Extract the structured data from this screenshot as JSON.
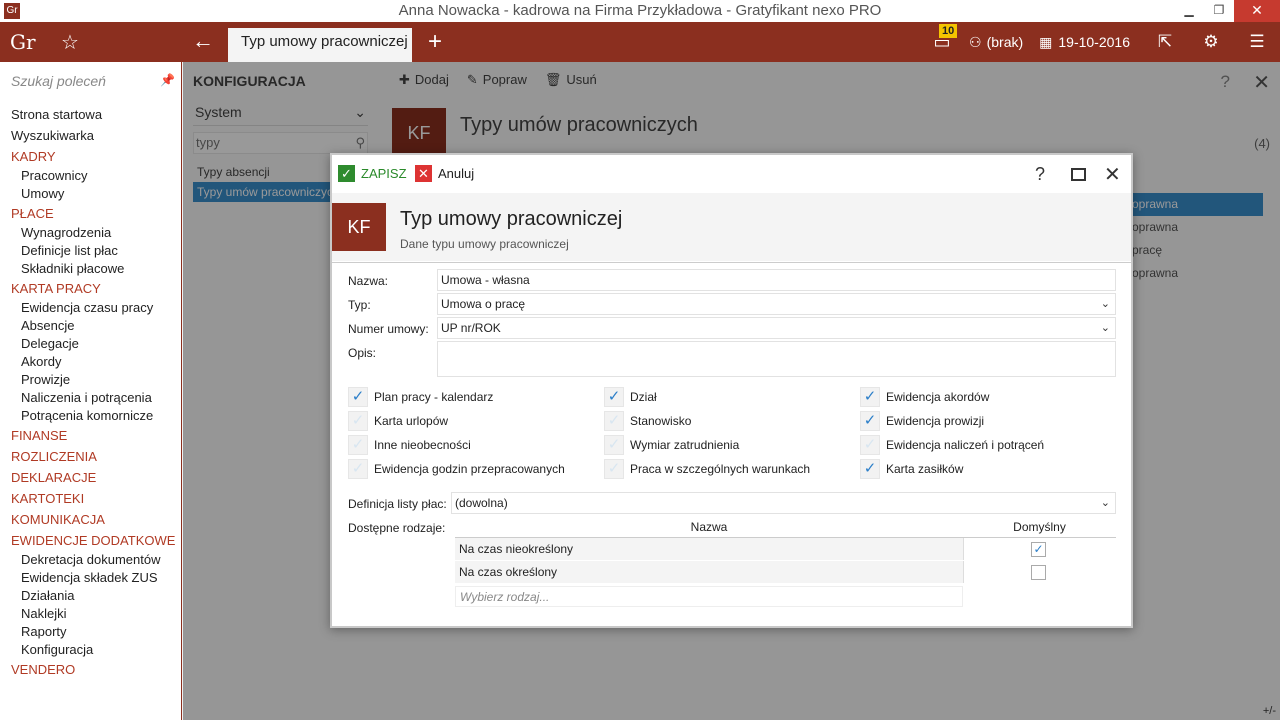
{
  "window": {
    "title": "Anna Nowacka - kadrowa na Firma Przykładowa - Gratyfikant nexo PRO",
    "app_icon": "Gr",
    "minimize": "▁",
    "restore": "❐",
    "close": "✕"
  },
  "appbar": {
    "logo": "Gr",
    "active_tab": "Typ umowy pracowniczej",
    "notifications_count": "10",
    "user": "(brak)",
    "date": "19-10-2016"
  },
  "sidebar": {
    "search_placeholder": "Szukaj poleceń",
    "items": [
      {
        "label": "Strona startowa"
      },
      {
        "label": "Wyszukiwarka"
      },
      {
        "label": "KADRY"
      },
      {
        "label": "Pracownicy"
      },
      {
        "label": "Umowy"
      },
      {
        "label": "PŁACE"
      },
      {
        "label": "Wynagrodzenia"
      },
      {
        "label": "Definicje list płac"
      },
      {
        "label": "Składniki płacowe"
      },
      {
        "label": "KARTA PRACY"
      },
      {
        "label": "Ewidencja czasu pracy"
      },
      {
        "label": "Absencje"
      },
      {
        "label": "Delegacje"
      },
      {
        "label": "Akordy"
      },
      {
        "label": "Prowizje"
      },
      {
        "label": "Naliczenia i potrącenia"
      },
      {
        "label": "Potrącenia komornicze"
      },
      {
        "label": "FINANSE"
      },
      {
        "label": "ROZLICZENIA"
      },
      {
        "label": "DEKLARACJE"
      },
      {
        "label": "KARTOTEKI"
      },
      {
        "label": "KOMUNIKACJA"
      },
      {
        "label": "EWIDENCJE DODATKOWE"
      },
      {
        "label": "Dekretacja dokumentów"
      },
      {
        "label": "Ewidencja składek ZUS"
      },
      {
        "label": "Działania"
      },
      {
        "label": "Naklejki"
      },
      {
        "label": "Raporty"
      },
      {
        "label": "Konfiguracja"
      },
      {
        "label": "VENDERO"
      }
    ]
  },
  "background": {
    "config_title": "KONFIGURACJA",
    "toolbar": {
      "add": "Dodaj",
      "edit": "Popraw",
      "delete": "Usuń"
    },
    "system_select": "System",
    "filter_value": "typy",
    "list": [
      "Typy absencji",
      "Typy umów pracowniczych"
    ],
    "badge": "KF",
    "page_title": "Typy umów pracowniczych",
    "count": "(4)",
    "rows": [
      "oprawna",
      "oprawna",
      "pracę",
      "oprawna"
    ],
    "resize": "+/-"
  },
  "dialog": {
    "save_label": "ZAPISZ",
    "cancel_label": "Anuluj",
    "help": "?",
    "badge": "KF",
    "title": "Typ umowy pracowniczej",
    "subtitle": "Dane typu umowy pracowniczej",
    "fields": {
      "name_label": "Nazwa:",
      "name_value": "Umowa - własna",
      "type_label": "Typ:",
      "type_value": "Umowa o pracę",
      "number_label": "Numer umowy:",
      "number_value": "UP nr/ROK",
      "desc_label": "Opis:",
      "desc_value": "",
      "payroll_label": "Definicja listy płac:",
      "payroll_value": "(dowolna)",
      "kinds_label": "Dostępne rodzaje:"
    },
    "checkboxes": [
      {
        "label": "Plan pracy - kalendarz",
        "checked": true
      },
      {
        "label": "Karta urlopów",
        "checked": false
      },
      {
        "label": "Inne nieobecności",
        "checked": false
      },
      {
        "label": "Ewidencja godzin przepracowanych",
        "checked": false
      },
      {
        "label": "Dział",
        "checked": true
      },
      {
        "label": "Stanowisko",
        "checked": false
      },
      {
        "label": "Wymiar zatrudnienia",
        "checked": false
      },
      {
        "label": "Praca w szczególnych warunkach",
        "checked": false
      },
      {
        "label": "Ewidencja akordów",
        "checked": true
      },
      {
        "label": "Ewidencja prowizji",
        "checked": true
      },
      {
        "label": "Ewidencja naliczeń i potrąceń",
        "checked": false
      },
      {
        "label": "Karta zasiłków",
        "checked": true
      }
    ],
    "grid": {
      "col_name": "Nazwa",
      "col_default": "Domyślny",
      "rows": [
        {
          "name": "Na czas nieokreślony",
          "default": true
        },
        {
          "name": "Na czas określony",
          "default": false
        }
      ],
      "picker_placeholder": "Wybierz rodzaj..."
    }
  }
}
